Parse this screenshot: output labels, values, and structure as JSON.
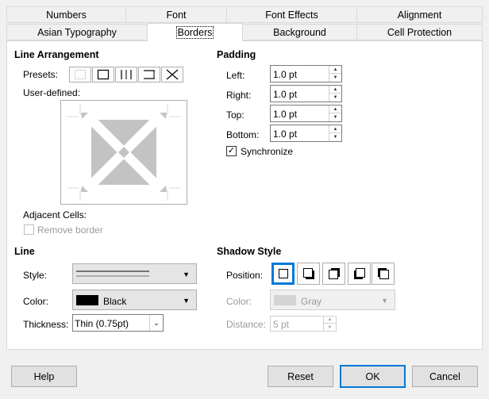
{
  "tabs_row1": [
    "Numbers",
    "Font",
    "Font Effects",
    "Alignment"
  ],
  "tabs_row2": [
    "Asian Typography",
    "Borders",
    "Background",
    "Cell Protection"
  ],
  "active_tab": "Borders",
  "line_arrangement": {
    "heading": "Line Arrangement",
    "presets_label": "Presets:",
    "user_defined_label": "User-defined:",
    "adjacent_cells_label": "Adjacent Cells:",
    "remove_border_label": "Remove border",
    "remove_border_checked": false
  },
  "padding": {
    "heading": "Padding",
    "left_label": "Left:",
    "left_value": "1.0 pt",
    "right_label": "Right:",
    "right_value": "1.0 pt",
    "top_label": "Top:",
    "top_value": "1.0 pt",
    "bottom_label": "Bottom:",
    "bottom_value": "1.0 pt",
    "synchronize_label": "Synchronize",
    "synchronize_checked": true,
    "synchronize_mark": "✓"
  },
  "line": {
    "heading": "Line",
    "style_label": "Style:",
    "color_label": "Color:",
    "color_value": "Black",
    "color_swatch": "#000000",
    "thickness_label": "Thickness:",
    "thickness_value": "Thin (0.75pt)"
  },
  "shadow_style": {
    "heading": "Shadow Style",
    "position_label": "Position:",
    "color_label": "Color:",
    "color_value": "Gray",
    "color_swatch": "#c0c0c0",
    "distance_label": "Distance:",
    "distance_value": "5 pt"
  },
  "buttons": {
    "help": "Help",
    "reset": "Reset",
    "ok": "OK",
    "cancel": "Cancel"
  },
  "colors": {
    "accent": "#0078d7",
    "border_preview": "#c3c3c3"
  }
}
